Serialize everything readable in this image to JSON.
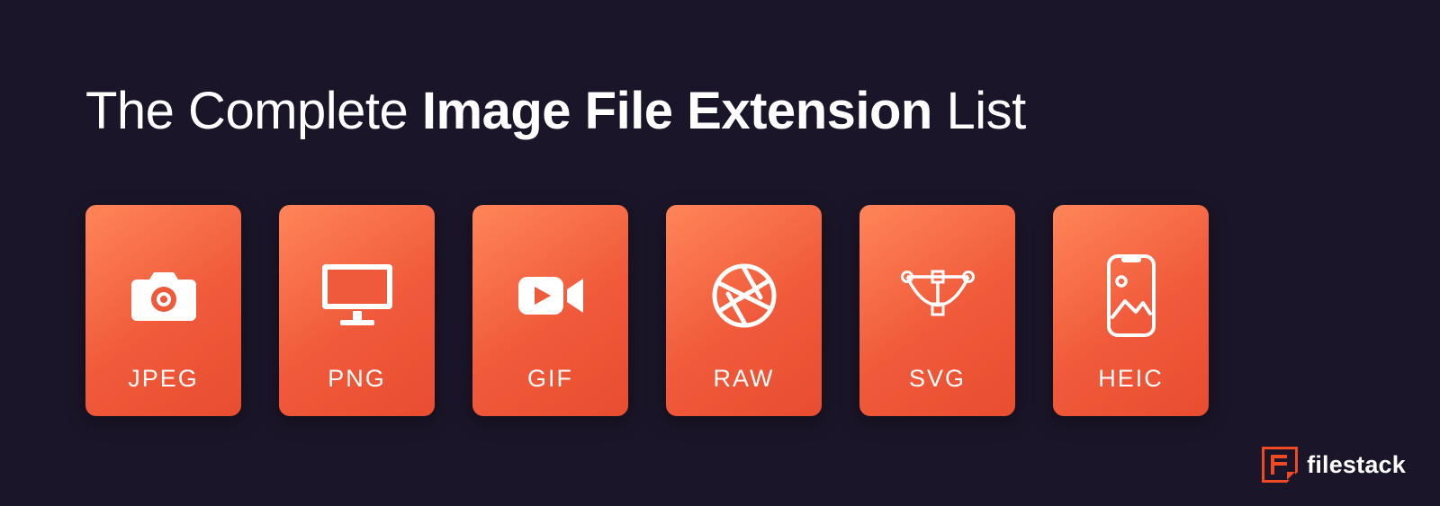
{
  "title": {
    "prefix": "The Complete ",
    "bold": "Image File Extension",
    "suffix": " List"
  },
  "cards": [
    {
      "label": "JPEG",
      "icon": "camera-icon"
    },
    {
      "label": "PNG",
      "icon": "monitor-icon"
    },
    {
      "label": "GIF",
      "icon": "video-camera-icon"
    },
    {
      "label": "RAW",
      "icon": "aperture-icon"
    },
    {
      "label": "SVG",
      "icon": "vector-pen-icon"
    },
    {
      "label": "HEIC",
      "icon": "phone-image-icon"
    }
  ],
  "brand": {
    "name": "filestack"
  },
  "colors": {
    "background": "#1a1528",
    "card_gradient_start": "#ff8559",
    "card_gradient_end": "#e84d2f",
    "accent": "#ef4a23",
    "text": "#ffffff"
  }
}
